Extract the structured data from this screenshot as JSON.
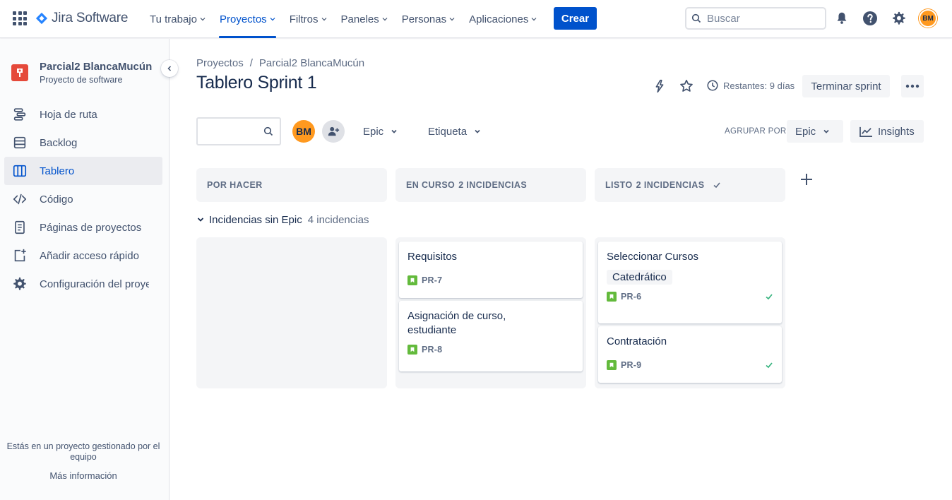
{
  "app": {
    "name": "Jira Software"
  },
  "topnav": {
    "items": [
      {
        "label": "Tu trabajo"
      },
      {
        "label": "Proyectos"
      },
      {
        "label": "Filtros"
      },
      {
        "label": "Paneles"
      },
      {
        "label": "Personas"
      },
      {
        "label": "Aplicaciones"
      }
    ],
    "active": "Proyectos",
    "create_label": "Crear",
    "search_placeholder": "Buscar",
    "user_initials": "BM"
  },
  "sidebar": {
    "project_name": "Parcial2 BlancaMucún",
    "project_type": "Proyecto de software",
    "items": [
      {
        "label": "Hoja de ruta",
        "icon": "roadmap-icon"
      },
      {
        "label": "Backlog",
        "icon": "backlog-icon"
      },
      {
        "label": "Tablero",
        "icon": "board-icon"
      },
      {
        "label": "Código",
        "icon": "code-icon"
      },
      {
        "label": "Páginas de proyectos",
        "icon": "page-icon"
      },
      {
        "label": "Añadir acceso rápido",
        "icon": "add-shortcut-icon"
      },
      {
        "label": "Configuración del proyecto",
        "icon": "settings-icon"
      }
    ],
    "active_item": "Tablero",
    "footer_text": "Estás en un proyecto gestionado por el equipo",
    "footer_link": "Más información"
  },
  "board": {
    "breadcrumbs": [
      "Proyectos",
      "Parcial2 BlancaMucún"
    ],
    "breadcrumb_separator": "/",
    "title": "Tablero Sprint 1",
    "remaining": "Restantes: 9 días",
    "end_sprint_label": "Terminar sprint",
    "assignee_initials": "BM",
    "filters": [
      "Epic",
      "Etiqueta"
    ],
    "group_by_label": "AGRUPAR POR",
    "group_by_value": "Epic",
    "insights_label": "Insights",
    "columns": [
      {
        "name": "POR HACER",
        "count": ""
      },
      {
        "name": "EN CURSO",
        "count": "2 INCIDENCIAS"
      },
      {
        "name": "LISTO",
        "count": "2 INCIDENCIAS"
      }
    ],
    "swimlane": {
      "title": "Incidencias sin Epic",
      "count": "4 incidencias"
    },
    "cards": {
      "in_progress": [
        {
          "title": "Requisitos",
          "key": "PR-7"
        },
        {
          "title": "Asignación de curso, estudiante",
          "key": "PR-8"
        }
      ],
      "done": [
        {
          "title": "Seleccionar Cursos",
          "label": "Catedrático",
          "key": "PR-6"
        },
        {
          "title": "Contratación",
          "key": "PR-9"
        }
      ]
    }
  },
  "colors": {
    "primary": "#0052cc",
    "story": "#63ba3c",
    "avatar": "#ff991f",
    "project": "#e5493a",
    "done": "#36b37e"
  }
}
